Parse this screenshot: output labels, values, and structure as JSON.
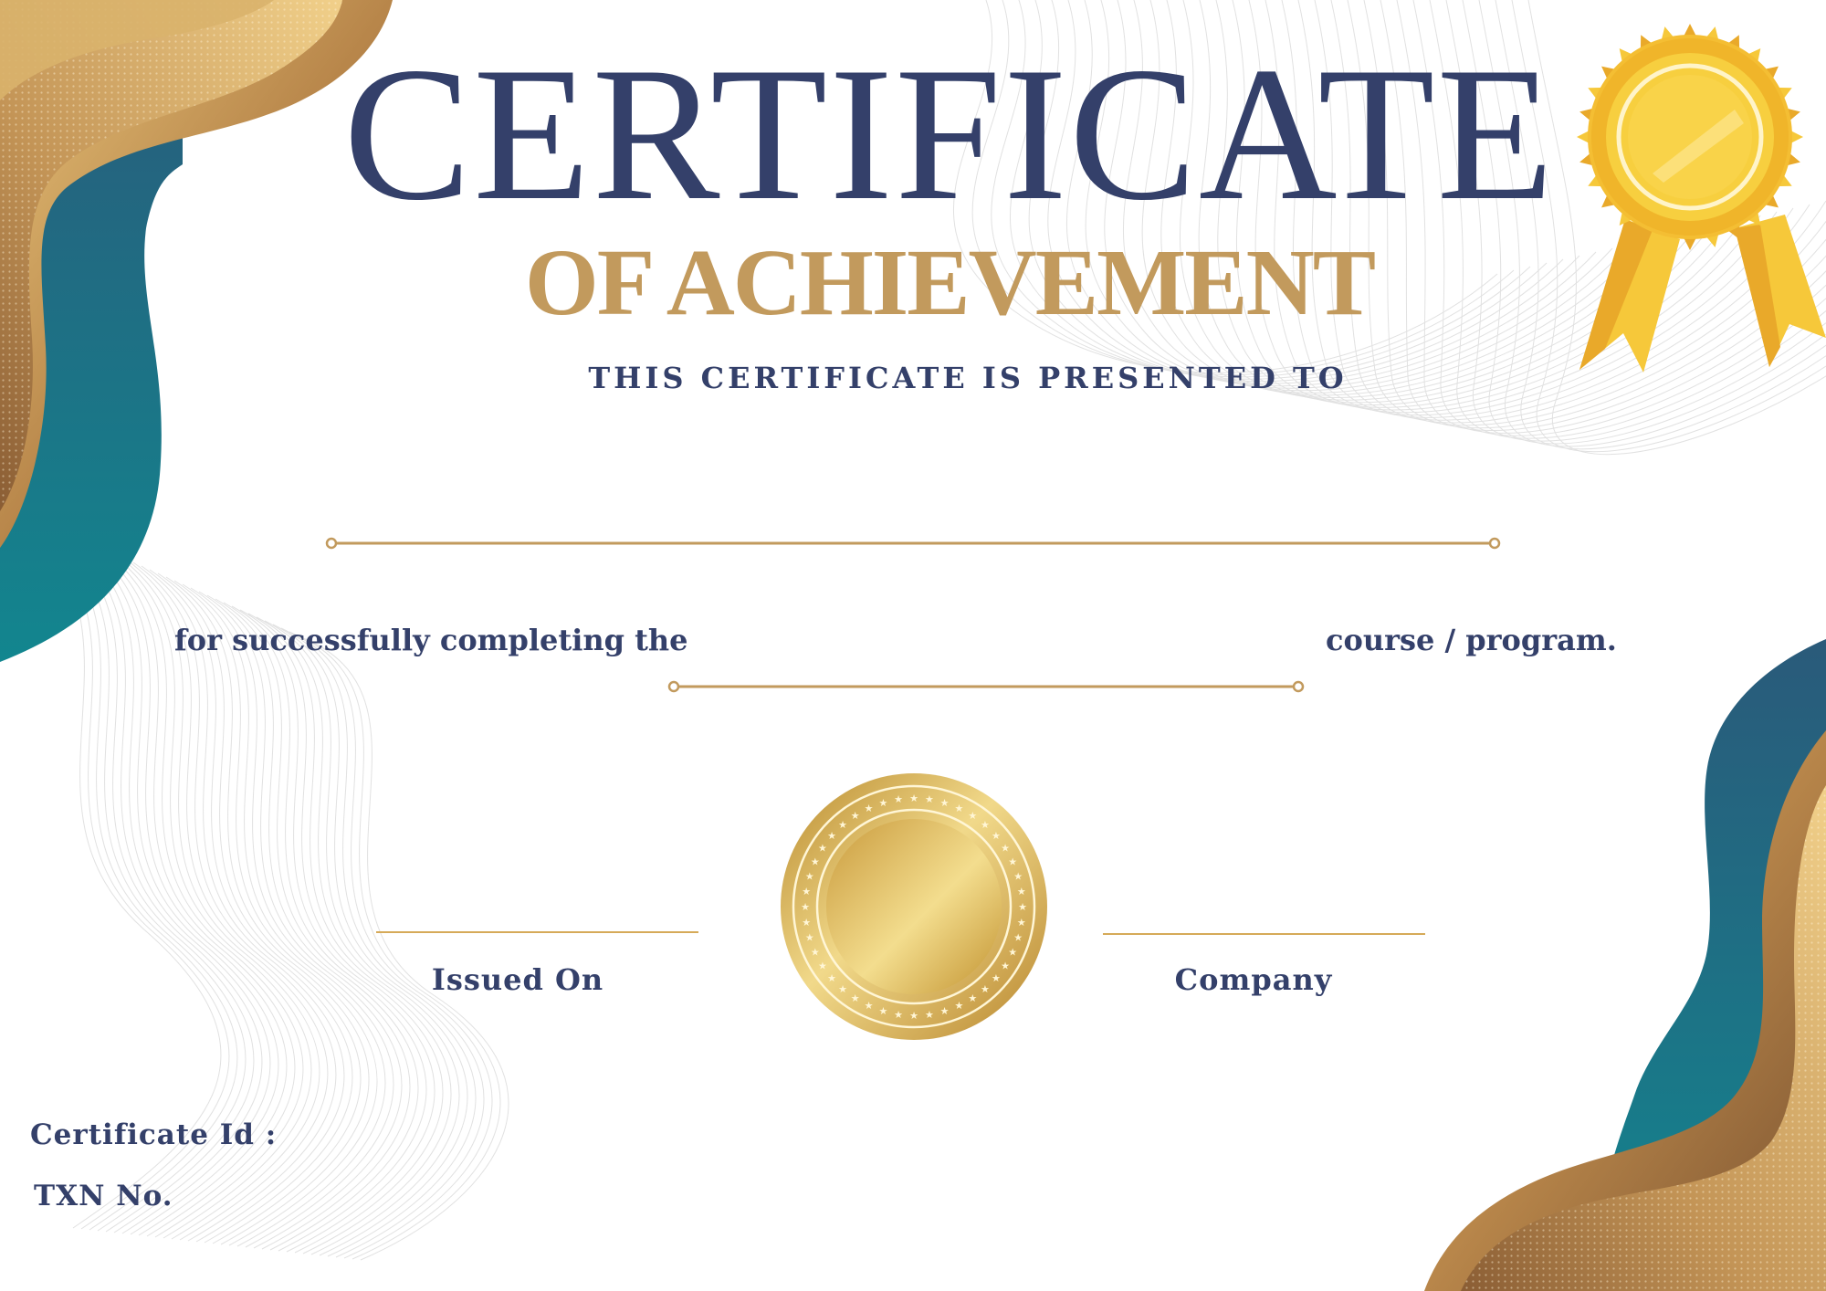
{
  "certificate": {
    "title": "CERTIFICATE",
    "subtitle": "OF ACHIEVEMENT",
    "presented_to": "THIS CERTIFICATE IS PRESENTED TO",
    "completion_prefix": "for successfully completing the",
    "completion_suffix": "course / program.",
    "issued_on_label": "Issued On",
    "company_label": "Company",
    "certificate_id_label": "Certificate Id :",
    "txn_label": "TXN No."
  },
  "colors": {
    "navy": "#34406a",
    "gold": "#c29a5d",
    "teal": "#16808c",
    "ribbon_yellow": "#f6c83a"
  },
  "icons": {
    "rosette": "award-rosette-icon",
    "seal": "gold-seal-icon"
  }
}
